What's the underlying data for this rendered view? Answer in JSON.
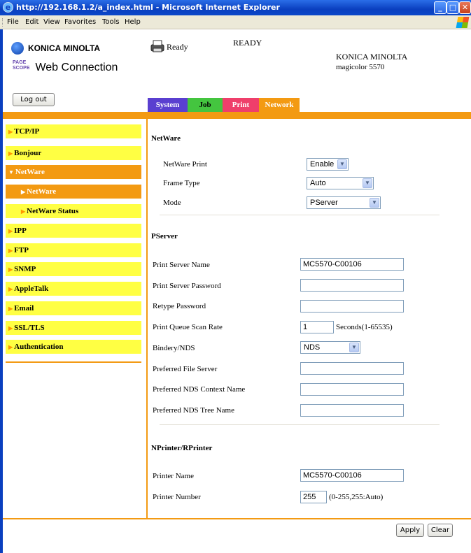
{
  "window": {
    "title": "http://192.168.1.2/a_index.html - Microsoft Internet Explorer",
    "controls": [
      "minimize",
      "maximize",
      "close"
    ]
  },
  "menubar": {
    "items": [
      "File",
      "Edit",
      "View",
      "Favorites",
      "Tools",
      "Help"
    ]
  },
  "header": {
    "brand_logo": "KONICA MINOLTA",
    "pagescope_small": "PAGE SCOPE",
    "product_logo": "Web Connection",
    "status_label": "Ready",
    "status_caps": "READY",
    "device_brand": "KONICA MINOLTA",
    "device_model": "magicolor 5570",
    "logout_label": "Log out"
  },
  "tabs": [
    {
      "label": "System",
      "color": "#5a3fd0"
    },
    {
      "label": "Job",
      "color": "#44c53f"
    },
    {
      "label": "Print",
      "color": "#ef3f6b"
    },
    {
      "label": "Network",
      "color": "#f39a12"
    }
  ],
  "sidebar": {
    "items": [
      {
        "label": "TCP/IP",
        "active": false,
        "sub": false
      },
      {
        "label": "Bonjour",
        "active": false,
        "sub": false
      },
      {
        "label": "NetWare",
        "active": true,
        "sub": false,
        "expanded": true
      },
      {
        "label": "NetWare",
        "active": true,
        "sub": true
      },
      {
        "label": "NetWare Status",
        "active": false,
        "sub": true
      },
      {
        "label": "IPP",
        "active": false,
        "sub": false
      },
      {
        "label": "FTP",
        "active": false,
        "sub": false
      },
      {
        "label": "SNMP",
        "active": false,
        "sub": false
      },
      {
        "label": "AppleTalk",
        "active": false,
        "sub": false
      },
      {
        "label": "Email",
        "active": false,
        "sub": false
      },
      {
        "label": "SSL/TLS",
        "active": false,
        "sub": false
      },
      {
        "label": "Authentication",
        "active": false,
        "sub": false
      }
    ]
  },
  "netware": {
    "title": "NetWare",
    "print_label": "NetWare Print",
    "print_value": "Enable",
    "frame_label": "Frame Type",
    "frame_value": "Auto",
    "mode_label": "Mode",
    "mode_value": "PServer"
  },
  "pserver": {
    "title": "PServer",
    "server_name_label": "Print Server Name",
    "server_name_value": "MC5570-C00106",
    "password_label": "Print Server Password",
    "password_value": "",
    "retype_label": "Retype Password",
    "retype_value": "",
    "scan_rate_label": "Print Queue Scan Rate",
    "scan_rate_value": "1",
    "scan_rate_unit": "Seconds(1-65535)",
    "bindery_label": "Bindery/NDS",
    "bindery_value": "NDS",
    "file_server_label": "Preferred File Server",
    "file_server_value": "",
    "nds_context_label": "Preferred NDS Context Name",
    "nds_context_value": "",
    "nds_tree_label": "Preferred NDS Tree Name",
    "nds_tree_value": ""
  },
  "nprinter": {
    "title": "NPrinter/RPrinter",
    "printer_name_label": "Printer Name",
    "printer_name_value": "MC5570-C00106",
    "printer_number_label": "Printer Number",
    "printer_number_value": "255",
    "printer_number_hint": "(0-255,255:Auto)"
  },
  "actions": {
    "apply_label": "Apply",
    "clear_label": "Clear"
  }
}
